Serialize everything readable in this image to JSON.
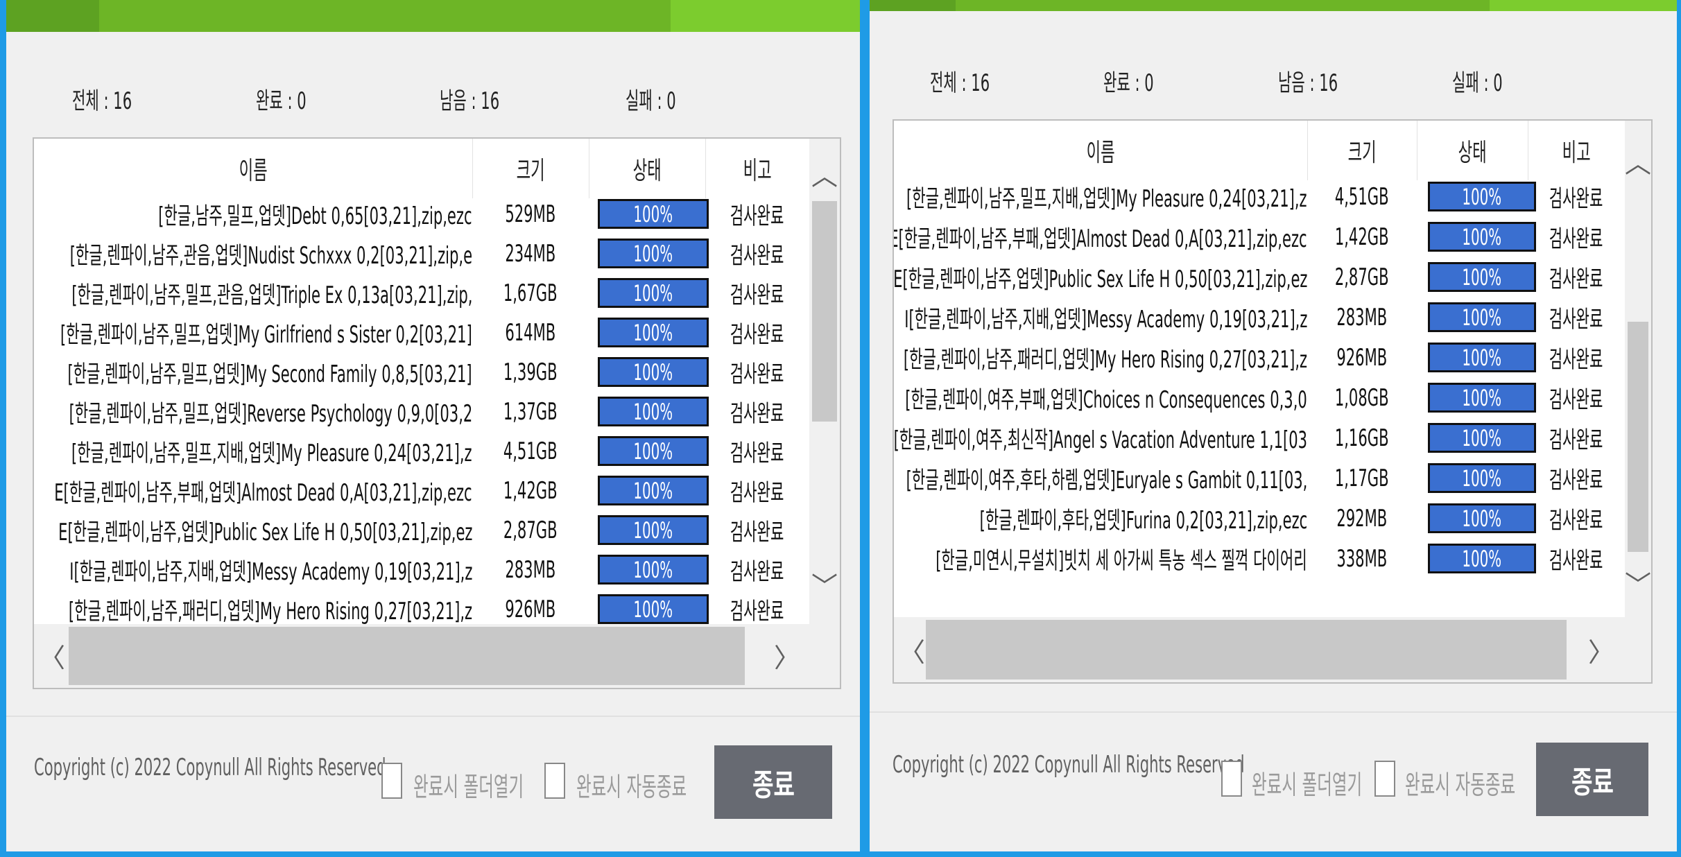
{
  "left": {
    "stats": {
      "total": "전체 : 16",
      "done": "완료 : 0",
      "remain": "남음 : 16",
      "fail": "실패 : 0"
    },
    "headers": {
      "name": "이름",
      "size": "크기",
      "status": "상태",
      "note": "비고"
    },
    "rows": [
      {
        "name": "[한글,남주,밀프,업뎃]Debt 0,65[03,21],zip,ezc",
        "size": "529MB",
        "status": "100%",
        "note": "검사완료"
      },
      {
        "name": "[한글,렌파이,남주,관음,업뎃]Nudist Schxxx 0,2[03,21],zip,e",
        "size": "234MB",
        "status": "100%",
        "note": "검사완료"
      },
      {
        "name": "[한글,렌파이,남주,밀프,관음,업뎃]Triple Ex 0,13a[03,21],zip,",
        "size": "1,67GB",
        "status": "100%",
        "note": "검사완료"
      },
      {
        "name": "[한글,렌파이,남주,밀프,업뎃]My Girlfriend s Sister 0,2[03,21]",
        "size": "614MB",
        "status": "100%",
        "note": "검사완료"
      },
      {
        "name": "[한글,렌파이,남주,밀프,업뎃]My Second Family 0,8,5[03,21]",
        "size": "1,39GB",
        "status": "100%",
        "note": "검사완료"
      },
      {
        "name": "[한글,렌파이,남주,밀프,업뎃]Reverse Psychology 0,9,0[03,2",
        "size": "1,37GB",
        "status": "100%",
        "note": "검사완료"
      },
      {
        "name": "[한글,렌파이,남주,밀프,지배,업뎃]My Pleasure 0,24[03,21],z",
        "size": "4,51GB",
        "status": "100%",
        "note": "검사완료"
      },
      {
        "name": "E[한글,렌파이,남주,부패,업뎃]Almost Dead 0,A[03,21],zip,ezc",
        "size": "1,42GB",
        "status": "100%",
        "note": "검사완료"
      },
      {
        "name": "E[한글,렌파이,남주,업뎃]Public Sex Life H 0,50[03,21],zip,ez",
        "size": "2,87GB",
        "status": "100%",
        "note": "검사완료"
      },
      {
        "name": "I[한글,렌파이,남주,지배,업뎃]Messy Academy 0,19[03,21],z",
        "size": "283MB",
        "status": "100%",
        "note": "검사완료"
      },
      {
        "name": "[한글,렌파이,남주,패러디,업뎃]My Hero Rising 0,27[03,21],z",
        "size": "926MB",
        "status": "100%",
        "note": "검사완료"
      }
    ],
    "copyright": "Copyright (c) 2022 Copynull All Rights Reserved",
    "open_folder_label": "완료시 폴더열기",
    "auto_close_label": "완료시 자동종료",
    "close_label": "종료"
  },
  "right": {
    "stats": {
      "total": "전체 : 16",
      "done": "완료 : 0",
      "remain": "남음 : 16",
      "fail": "실패 : 0"
    },
    "headers": {
      "name": "이름",
      "size": "크기",
      "status": "상태",
      "note": "비고"
    },
    "rows": [
      {
        "name": "[한글,렌파이,남주,밀프,지배,업뎃]My Pleasure 0,24[03,21],z",
        "size": "4,51GB",
        "status": "100%",
        "note": "검사완료"
      },
      {
        "name": "E[한글,렌파이,남주,부패,업뎃]Almost Dead 0,A[03,21],zip,ezc",
        "size": "1,42GB",
        "status": "100%",
        "note": "검사완료"
      },
      {
        "name": "E[한글,렌파이,남주,업뎃]Public Sex Life H 0,50[03,21],zip,ez",
        "size": "2,87GB",
        "status": "100%",
        "note": "검사완료"
      },
      {
        "name": "I[한글,렌파이,남주,지배,업뎃]Messy Academy 0,19[03,21],z",
        "size": "283MB",
        "status": "100%",
        "note": "검사완료"
      },
      {
        "name": "[한글,렌파이,남주,패러디,업뎃]My Hero Rising 0,27[03,21],z",
        "size": "926MB",
        "status": "100%",
        "note": "검사완료"
      },
      {
        "name": "[한글,렌파이,여주,부패,업뎃]Choices n Consequences 0,3,0",
        "size": "1,08GB",
        "status": "100%",
        "note": "검사완료"
      },
      {
        "name": "[한글,렌파이,여주,최신작]Angel s Vacation Adventure 1,1[03",
        "size": "1,16GB",
        "status": "100%",
        "note": "검사완료"
      },
      {
        "name": "[한글,렌파이,여주,후타,하렘,업뎃]Euryale s Gambit 0,11[03,",
        "size": "1,17GB",
        "status": "100%",
        "note": "검사완료"
      },
      {
        "name": "[한글,렌파이,후타,업뎃]Furina 0,2[03,21],zip,ezc",
        "size": "292MB",
        "status": "100%",
        "note": "검사완료"
      },
      {
        "name": "[한글,미연시,무설치]빗치 세 아가씨 특농 섹스 찔꺽 다이어리",
        "size": "338MB",
        "status": "100%",
        "note": "검사완료"
      }
    ],
    "copyright": "Copyright (c) 2022 Copynull All Rights Reserved",
    "open_folder_label": "완료시 폴더열기",
    "auto_close_label": "완료시 자동종료",
    "close_label": "종료"
  }
}
